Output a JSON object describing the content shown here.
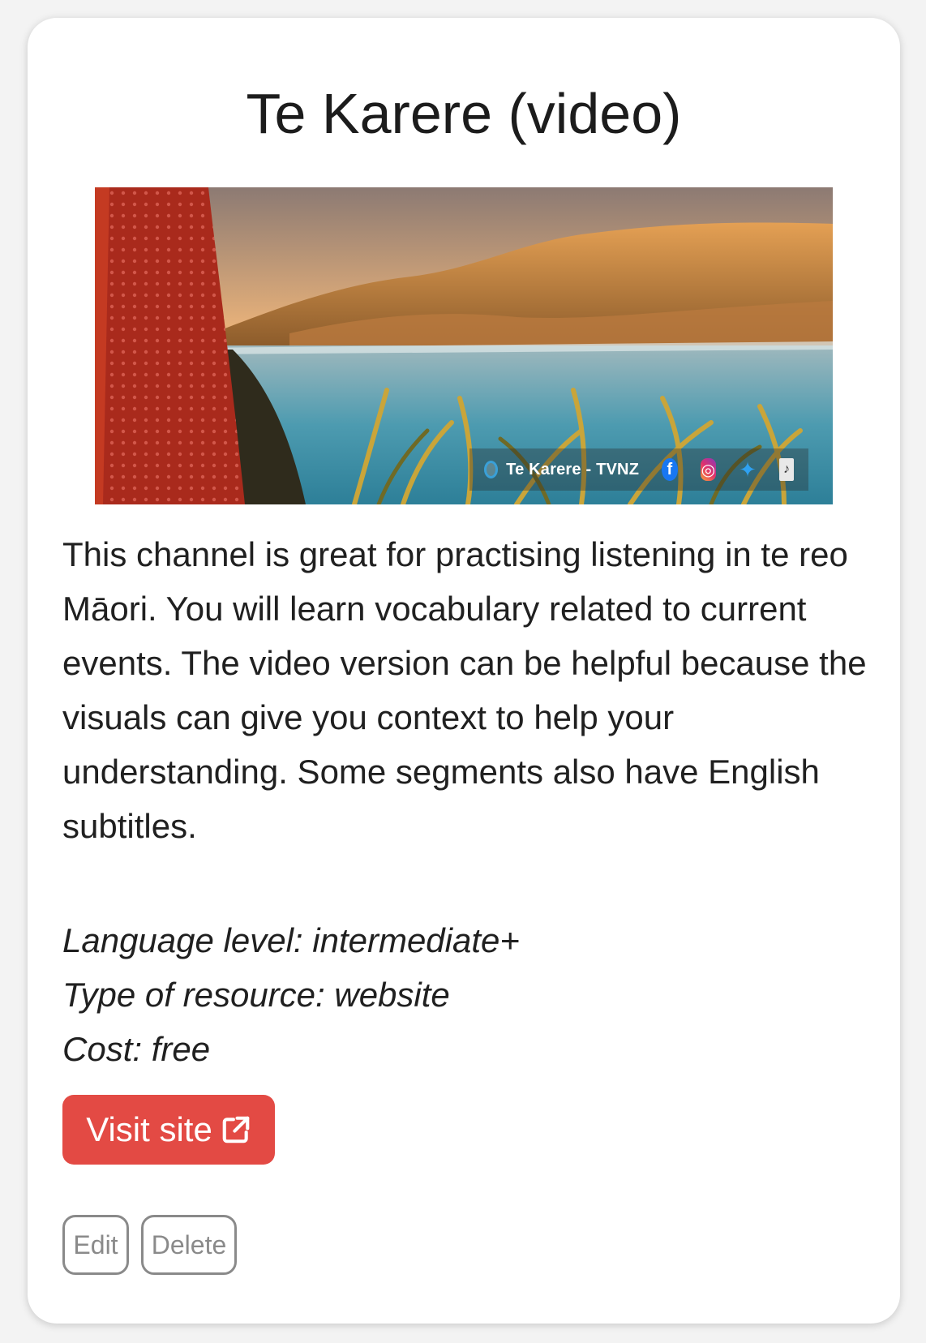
{
  "card": {
    "title": "Te Karere (video)",
    "banner": {
      "channel_label": "Te Karere - TVNZ",
      "icons": [
        "tvnz-logo-icon",
        "facebook-icon",
        "instagram-icon",
        "twitter-icon",
        "tiktok-icon"
      ]
    },
    "description": "This channel is great for practising listening in te reo Māori. You will learn vocabulary related to current events. The video version can be helpful because the visuals can give you context to help your understanding. Some segments also have English subtitles.",
    "meta": {
      "language_level": "Language level: intermediate+",
      "resource_type": "Type of resource: website",
      "cost": "Cost: free"
    },
    "buttons": {
      "visit_label": "Visit site",
      "edit_label": "Edit",
      "delete_label": "Delete"
    },
    "colors": {
      "visit_button": "#e34a44",
      "outline_button": "#8a8a8a",
      "banner_red": "#b5301f"
    }
  }
}
